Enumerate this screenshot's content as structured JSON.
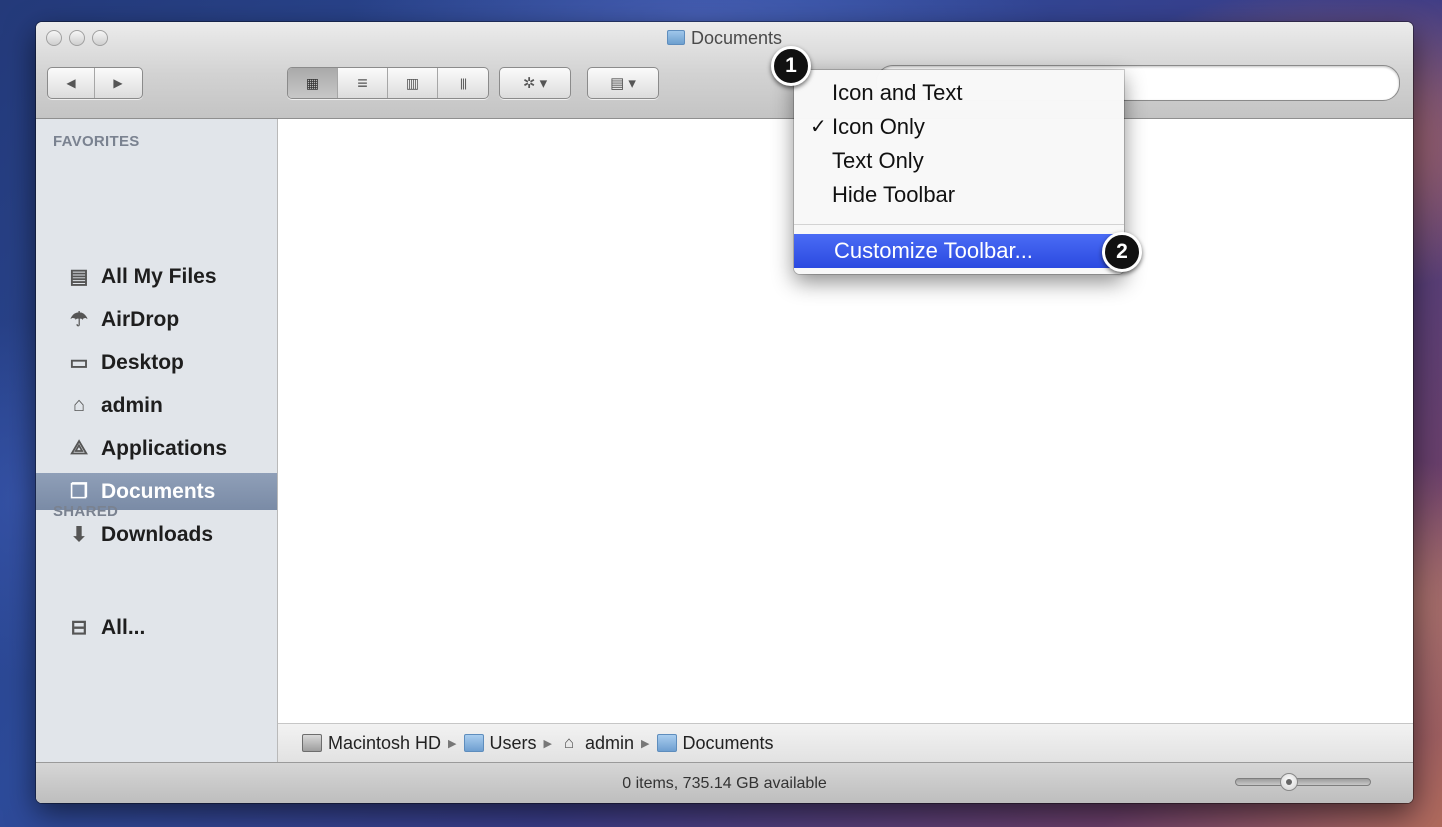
{
  "window": {
    "title": "Documents"
  },
  "toolbar": {
    "back_glyph": "◀",
    "forward_glyph": "▶",
    "view_icon": "▦",
    "view_list": "≡",
    "view_columns": "▥",
    "view_coverflow": "|||",
    "action_glyph": "✲ ▾",
    "arrange_glyph": "▤ ▾",
    "search_placeholder": ""
  },
  "sidebar": {
    "favorites_heading": "FAVORITES",
    "shared_heading": "SHARED",
    "items": [
      {
        "label": "All My Files",
        "icon": "all-my-files-icon",
        "glyph": "▤"
      },
      {
        "label": "AirDrop",
        "icon": "airdrop-icon",
        "glyph": "☂"
      },
      {
        "label": "Desktop",
        "icon": "desktop-icon",
        "glyph": "▭"
      },
      {
        "label": "admin",
        "icon": "home-icon",
        "glyph": "⌂"
      },
      {
        "label": "Applications",
        "icon": "applications-icon",
        "glyph": "⟁"
      },
      {
        "label": "Documents",
        "icon": "documents-icon",
        "glyph": "❐",
        "selected": true
      },
      {
        "label": "Downloads",
        "icon": "downloads-icon",
        "glyph": "⬇"
      }
    ],
    "shared_items": [
      {
        "label": "All...",
        "icon": "network-icon",
        "glyph": "⊟"
      }
    ]
  },
  "context_menu": {
    "items": [
      {
        "label": "Icon and Text",
        "checked": false
      },
      {
        "label": "Icon Only",
        "checked": true
      },
      {
        "label": "Text Only",
        "checked": false
      },
      {
        "label": "Hide Toolbar",
        "checked": false
      }
    ],
    "check_glyph": "✓",
    "customize_label": "Customize Toolbar..."
  },
  "callouts": {
    "step1": "1",
    "step2": "2"
  },
  "path_bar": {
    "segments": [
      "Macintosh HD",
      "Users",
      "admin",
      "Documents"
    ],
    "separator": "▶"
  },
  "status_bar": {
    "text": "0 items, 735.14 GB available"
  },
  "colors": {
    "menu_highlight": "#2b4ae0",
    "sidebar_selected": "#7a8ba6",
    "sidebar_bg": "#e1e5ea"
  }
}
